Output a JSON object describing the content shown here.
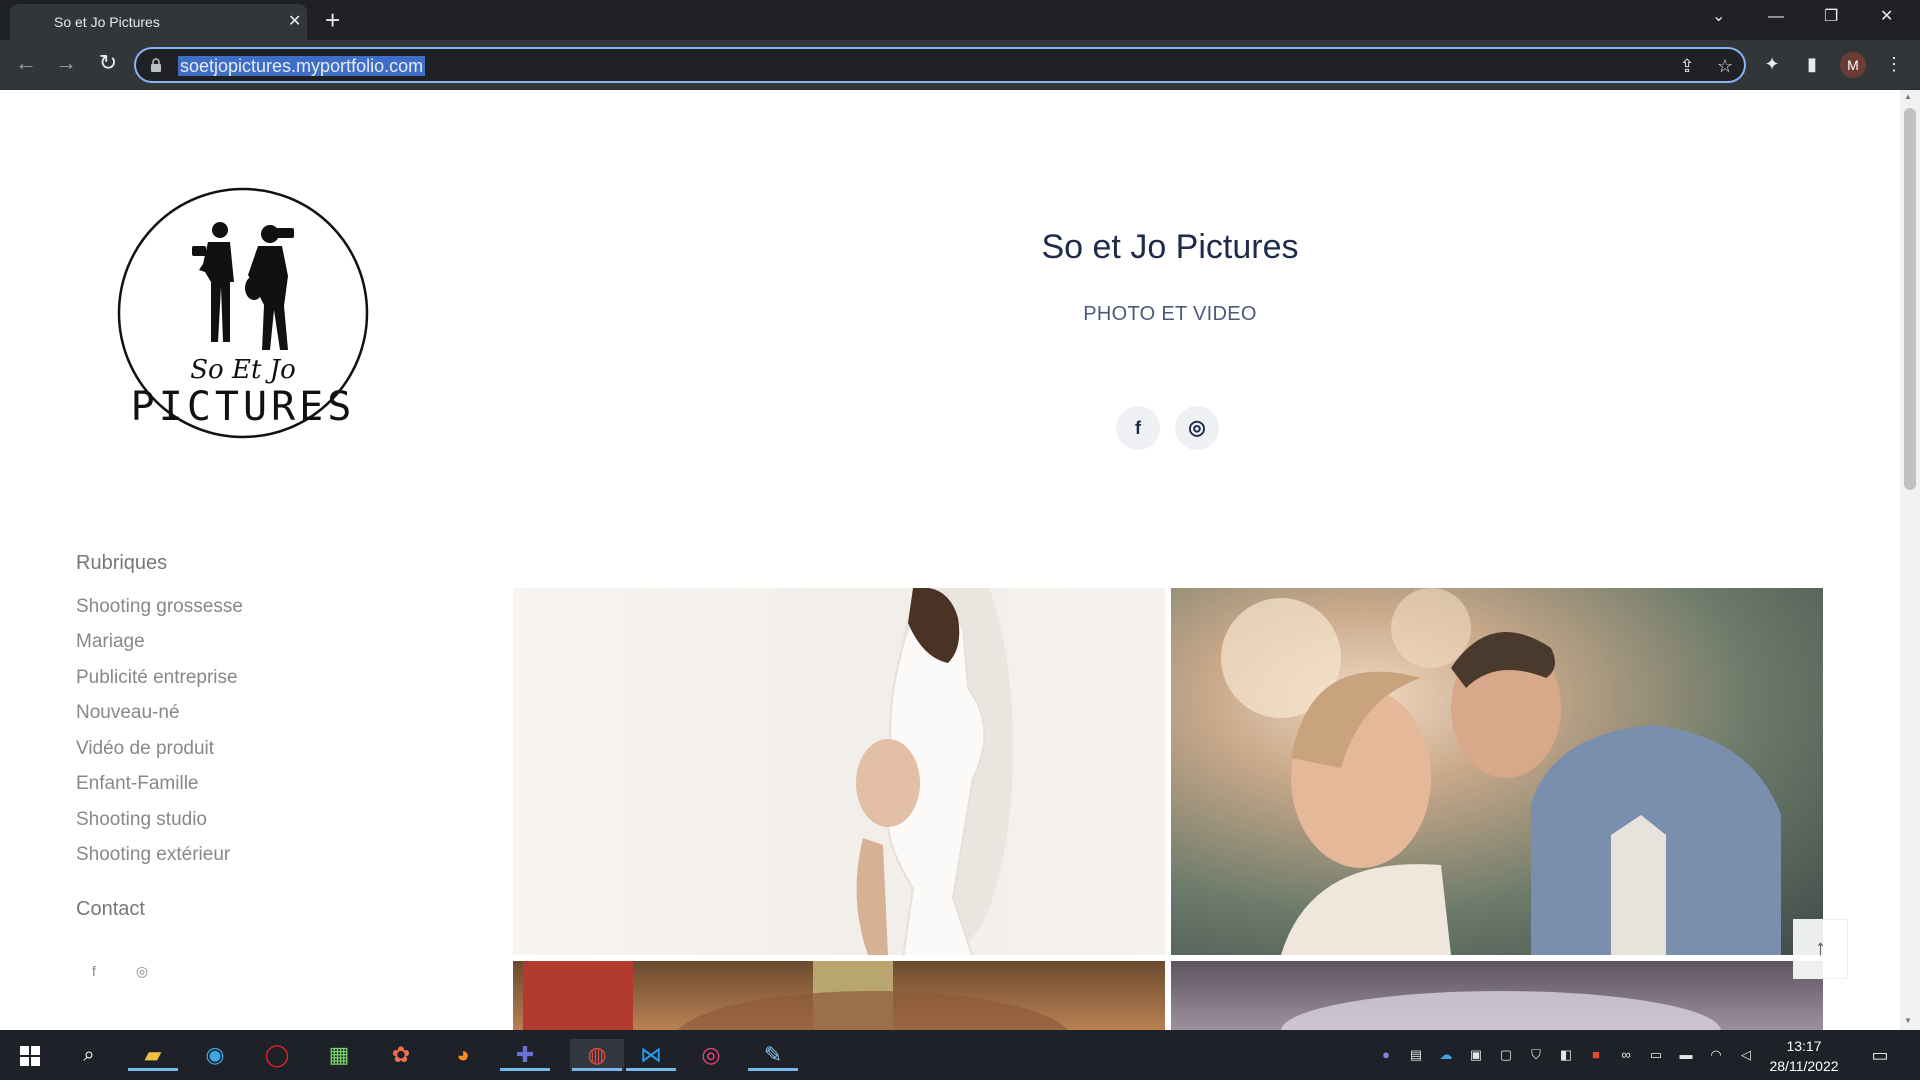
{
  "browser": {
    "tab_title": "So et Jo Pictures",
    "tab_close": "✕",
    "new_tab": "+",
    "url": "soetjopictures.myportfolio.com",
    "profile_initial": "M",
    "window_controls": [
      "⌄",
      "—",
      "❐",
      "✕"
    ]
  },
  "site": {
    "title": "So et Jo Pictures",
    "subtitle": "PHOTO ET VIDEO",
    "logo_text": [
      "So Et Jo",
      "PICTURES"
    ],
    "social": [
      "f",
      "◎"
    ]
  },
  "sidebar": {
    "section_heading": "Rubriques",
    "links": [
      "Shooting grossesse",
      "Mariage",
      "Publicité entreprise",
      "Nouveau-né",
      "Vidéo de produit",
      "Enfant-Famille",
      "Shooting studio",
      "Shooting extérieur"
    ],
    "contact_heading": "Contact",
    "social": [
      "f",
      "◎"
    ]
  },
  "gallery": {
    "back_to_top": "↑"
  },
  "taskbar": {
    "time": "13:17",
    "date": "28/11/2022"
  },
  "colors": {
    "title": "#1e2b4a",
    "sidebar_text": "#888888",
    "accent_url_highlight": "#3e6ec5"
  }
}
